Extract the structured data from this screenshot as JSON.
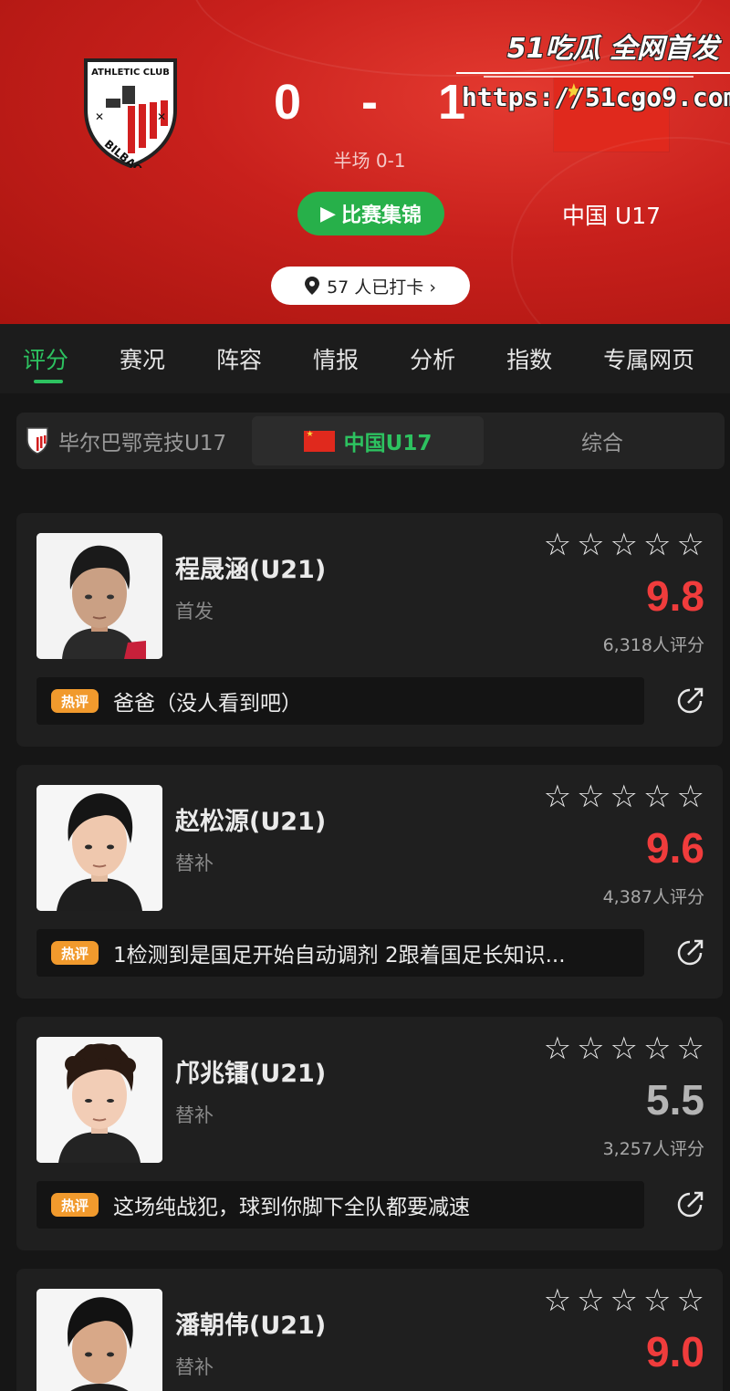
{
  "match": {
    "home_score": "0",
    "separator": "-",
    "away_score": "1",
    "halftime": "半场 0-1",
    "watch_button": "比赛集锦",
    "away_team": "中国 U17",
    "checkin": "57 人已打卡 ›",
    "home_crest_icon": "athletic-club-crest",
    "away_flag_icon": "china-flag"
  },
  "watermark": {
    "title": "51吃瓜 全网首发",
    "url": "https://51cgo9.com"
  },
  "tabs": [
    {
      "label": "评分",
      "active": true
    },
    {
      "label": "赛况"
    },
    {
      "label": "阵容"
    },
    {
      "label": "情报"
    },
    {
      "label": "分析"
    },
    {
      "label": "指数"
    },
    {
      "label": "专属网页"
    }
  ],
  "segment": {
    "home": "毕尔巴鄂竞技U17",
    "away": "中国U17",
    "overall": "综合"
  },
  "colors": {
    "accent_green": "#2dc260",
    "score_red": "#f03c3c",
    "header_red": "#c8201c",
    "badge_orange": "#f19a2d"
  },
  "players": [
    {
      "name": "程晟涵(U21)",
      "role": "首发",
      "score": "9.8",
      "score_color": "red",
      "count": "6,318人评分",
      "badge": "热评",
      "comment": "爸爸（没人看到吧）"
    },
    {
      "name": "赵松源(U21)",
      "role": "替补",
      "score": "9.6",
      "score_color": "red",
      "count": "4,387人评分",
      "badge": "热评",
      "comment": "1检测到是国足开始自动调剂 2跟着国足长知识..."
    },
    {
      "name": "邝兆镭(U21)",
      "role": "替补",
      "score": "5.5",
      "score_color": "grey",
      "count": "3,257人评分",
      "badge": "热评",
      "comment": "这场纯战犯，球到你脚下全队都要减速"
    },
    {
      "name": "潘朝伟(U21)",
      "role": "替补",
      "score": "9.0",
      "score_color": "red",
      "count": "",
      "badge": "",
      "comment": ""
    }
  ]
}
